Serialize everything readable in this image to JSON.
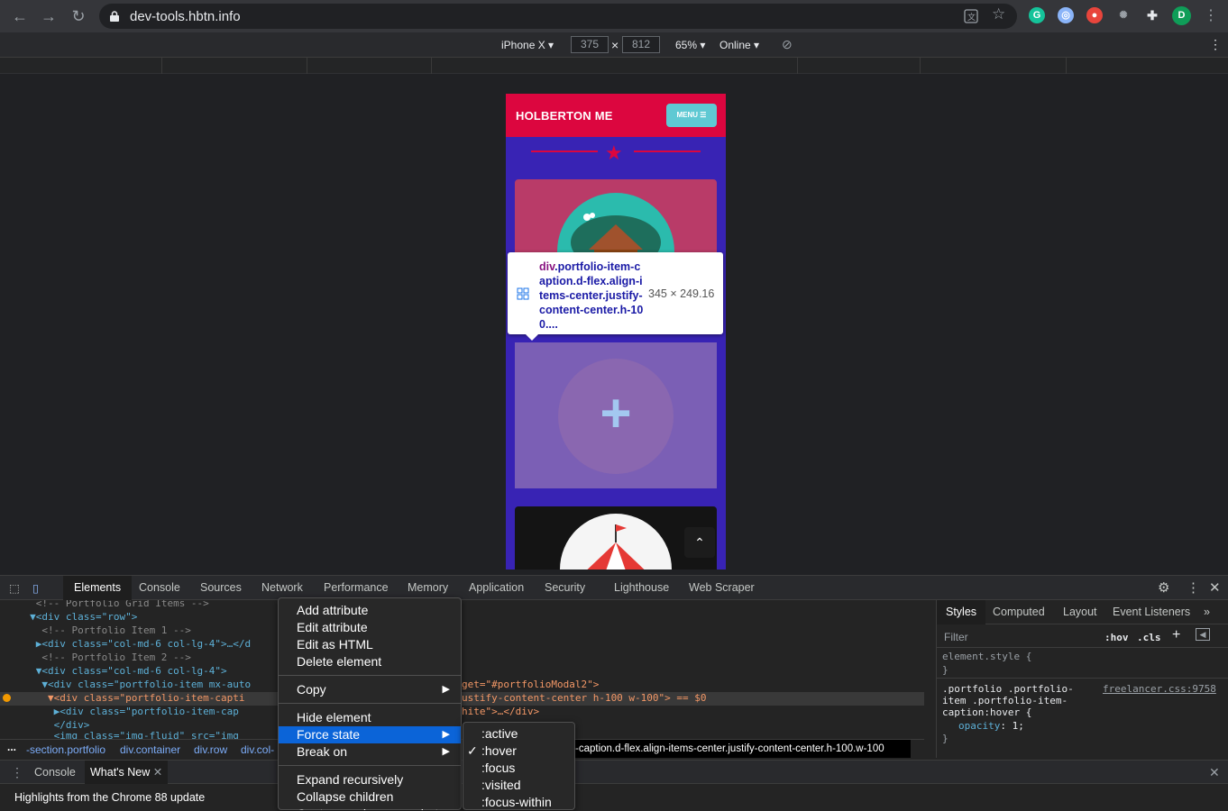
{
  "browser": {
    "url": "dev-tools.hbtn.info",
    "profile_initial": "D"
  },
  "device_toolbar": {
    "device": "iPhone X",
    "width": "375",
    "height": "812",
    "zoom": "65%",
    "throttle": "Online",
    "times": "×"
  },
  "phone": {
    "brand": "HOLBERTON ME",
    "menu_label": "MENU ☰",
    "plus": "+",
    "scroll_top": "⌃"
  },
  "tooltip": {
    "tag": "div",
    "selector": ".portfolio-item-caption.d-flex.align-items-center.justify-content-center.h-100....",
    "size": "345 × 249.16"
  },
  "devtools": {
    "tabs": [
      "Elements",
      "Console",
      "Sources",
      "Network",
      "Performance",
      "Memory",
      "Application",
      "Security",
      "Lighthouse",
      "Web Scraper"
    ],
    "dom_lines": [
      {
        "indent": "      ",
        "arrow": "",
        "content": "<!-- Portfolio Grid Items -->",
        "type": "cmt"
      },
      {
        "indent": "     ",
        "arrow": "▼",
        "content": "<div class=\"row\">",
        "type": "tag"
      },
      {
        "indent": "       ",
        "arrow": "",
        "content": "<!-- Portfolio Item 1 -->",
        "type": "cmt"
      },
      {
        "indent": "      ",
        "arrow": "▶",
        "content": "<div class=\"col-md-6 col-lg-4\">…</d",
        "type": "tag"
      },
      {
        "indent": "       ",
        "arrow": "",
        "content": "<!-- Portfolio Item 2 -->",
        "type": "cmt"
      },
      {
        "indent": "      ",
        "arrow": "▼",
        "content": "<div class=\"col-md-6 col-lg-4\">",
        "type": "tag"
      },
      {
        "indent": "       ",
        "arrow": "▼",
        "content": "<div class=\"portfolio-item mx-auto",
        "type": "tag"
      },
      {
        "indent": "        ",
        "arrow": "▼",
        "content": "<div class=\"portfolio-item-capti",
        "type": "tag"
      },
      {
        "indent": "         ",
        "arrow": "▶",
        "content": "<div class=\"portfolio-item-cap",
        "type": "tag"
      },
      {
        "indent": "         ",
        "arrow": "",
        "content": "</div>",
        "type": "tag"
      },
      {
        "indent": "         ",
        "arrow": "",
        "content": "<img class=\"img-fluid\" src=\"img",
        "type": "tag"
      }
    ],
    "dom_right": [
      "get=\"#portfolioModal2\">",
      "ustify-content-center h-100 w-100\"> == $0",
      "hite\">…</div>"
    ],
    "breadcrumbs": [
      "...",
      "-section.portfolio",
      "div.container",
      "div.row",
      "div.col-"
    ],
    "breadcrumb_last": "-caption.d-flex.align-items-center.justify-content-center.h-100.w-100",
    "styles_tabs": [
      "Styles",
      "Computed",
      "Layout",
      "Event Listeners"
    ],
    "styles_more": "»",
    "filter_placeholder": "Filter",
    "hov": ":hov",
    "cls": ".cls",
    "plus": "+",
    "element_style": "element.style {",
    "close_brace": "}",
    "rule_selector_1": ".portfolio .portfolio-",
    "rule_selector_2": "item .portfolio-item-",
    "rule_selector_3": "caption:hover {",
    "rule_source": "freelancer.css:9758",
    "rule_prop": "opacity",
    "rule_value": "1;",
    "drawer_tabs": [
      "Console",
      "What's New"
    ],
    "drawer_content": "Highlights from the Chrome 88 update"
  },
  "context_menu": {
    "items_group1": [
      "Add attribute",
      "Edit attribute",
      "Edit as HTML",
      "Delete element"
    ],
    "copy": "Copy",
    "hide": "Hide element",
    "force_state": "Force state",
    "break_on": "Break on",
    "expand": "Expand recursively",
    "collapse": "Collapse children",
    "capture": "Capture node screenshot",
    "submenu_arrow": "▶"
  },
  "force_state_menu": {
    "items": [
      ":active",
      ":hover",
      ":focus",
      ":visited",
      ":focus-within"
    ],
    "checked": ":hover",
    "check": "✓"
  },
  "colors": {
    "phone_header": "#dc063f",
    "phone_bg": "#3823b4",
    "menu_button": "#5fc9d3",
    "highlight": "#0b64d8"
  }
}
